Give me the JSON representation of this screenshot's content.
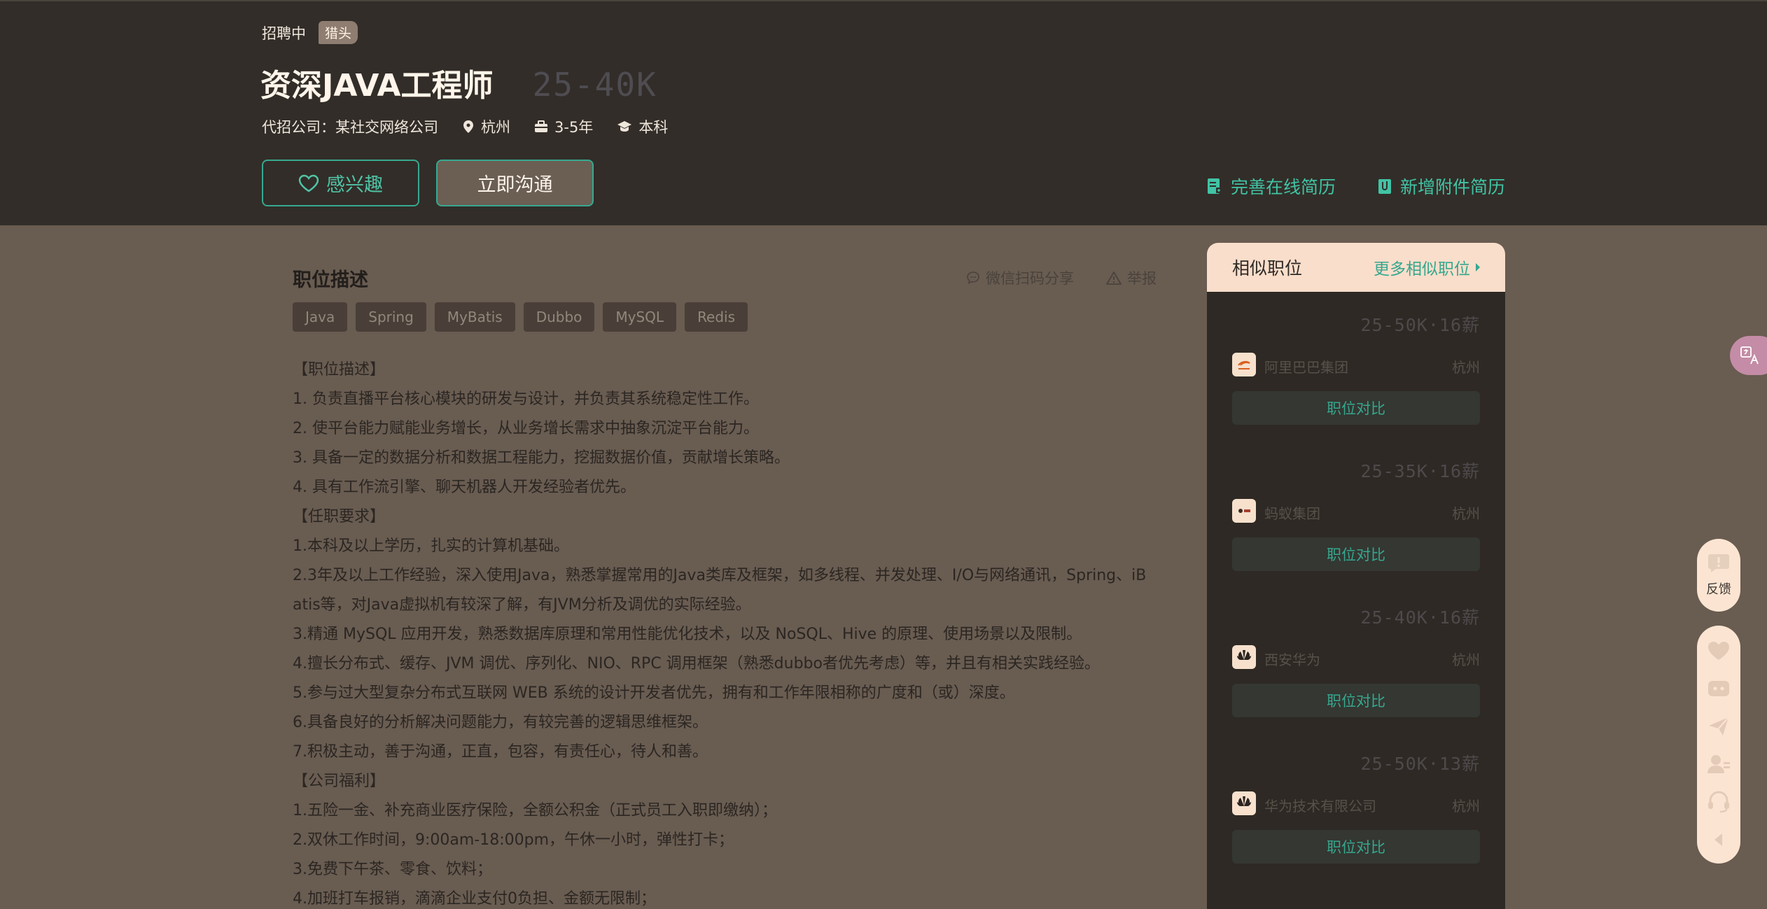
{
  "header": {
    "status": "招聘中",
    "tag": "猎头",
    "title": "资深JAVA工程师",
    "salary": "25-40K",
    "agency_company": "代招公司：某社交网络公司",
    "location": "杭州",
    "experience": "3-5年",
    "education": "本科",
    "interest_button": "感兴趣",
    "chat_button": "立即沟通",
    "complete_resume_link": "完善在线简历",
    "add_attachment_link": "新增附件简历"
  },
  "description": {
    "title": "职位描述",
    "share": "微信扫码分享",
    "report": "举报",
    "skills": [
      "Java",
      "Spring",
      "MyBatis",
      "Dubbo",
      "MySQL",
      "Redis"
    ],
    "lines": [
      "【职位描述】",
      "1. 负责直播平台核心模块的研发与设计，并负责其系统稳定性工作。",
      "2. 使平台能力赋能业务增长，从业务增长需求中抽象沉淀平台能力。",
      "3. 具备一定的数据分析和数据工程能力，挖掘数据价值，贡献增长策略。",
      "4. 具有工作流引擎、聊天机器人开发经验者优先。",
      "【任职要求】",
      "1.本科及以上学历，扎实的计算机基础。",
      "2.3年及以上工作经验，深入使用Java，熟悉掌握常用的Java类库及框架，如多线程、并发处理、I/O与网络通讯，Spring、iB",
      "atis等，对Java虚拟机有较深了解，有JVM分析及调优的实际经验。",
      "3.精通 MySQL 应用开发，熟悉数据库原理和常用性能优化技术，以及 NoSQL、Hive 的原理、使用场景以及限制。",
      "4.擅长分布式、缓存、JVM 调优、序列化、NIO、RPC 调用框架（熟悉dubbo者优先考虑）等，并且有相关实践经验。",
      "5.参与过大型复杂分布式互联网 WEB 系统的设计开发者优先，拥有和工作年限相称的广度和（或）深度。",
      "6.具备良好的分析解决问题能力，有较完善的逻辑思维框架。",
      "7.积极主动，善于沟通，正直，包容，有责任心，待人和善。",
      "【公司福利】",
      "1.五险一金、补充商业医疗保险，全额公积金（正式员工入职即缴纳）；",
      "2.双休工作时间，9:00am-18:00pm，午休一小时，弹性打卡；",
      "3.免费下午茶、零食、饮料；",
      "4.加班打车报销，滴滴企业支付0负担、金额无限制；"
    ]
  },
  "similar": {
    "title": "相似职位",
    "more": "更多相似职位",
    "compare_label": "职位对比",
    "jobs": [
      {
        "salary": "25-50K·16薪",
        "company": "阿里巴巴集团",
        "city": "杭州",
        "logo_icon": "alibaba-logo-icon"
      },
      {
        "salary": "25-35K·16薪",
        "company": "蚂蚁集团",
        "city": "杭州",
        "logo_icon": "ant-group-logo-icon"
      },
      {
        "salary": "25-40K·16薪",
        "company": "西安华为",
        "city": "杭州",
        "logo_icon": "huawei-logo-icon"
      },
      {
        "salary": "25-50K·13薪",
        "company": "华为技术有限公司",
        "city": "杭州",
        "logo_icon": "huawei-logo-icon"
      }
    ]
  },
  "sidebar": {
    "feedback": "反馈"
  },
  "colors": {
    "header_bg": "#322d28",
    "page_bg": "#695c51",
    "accent": "#36a78e",
    "panel_head_bg": "#f9decb"
  }
}
